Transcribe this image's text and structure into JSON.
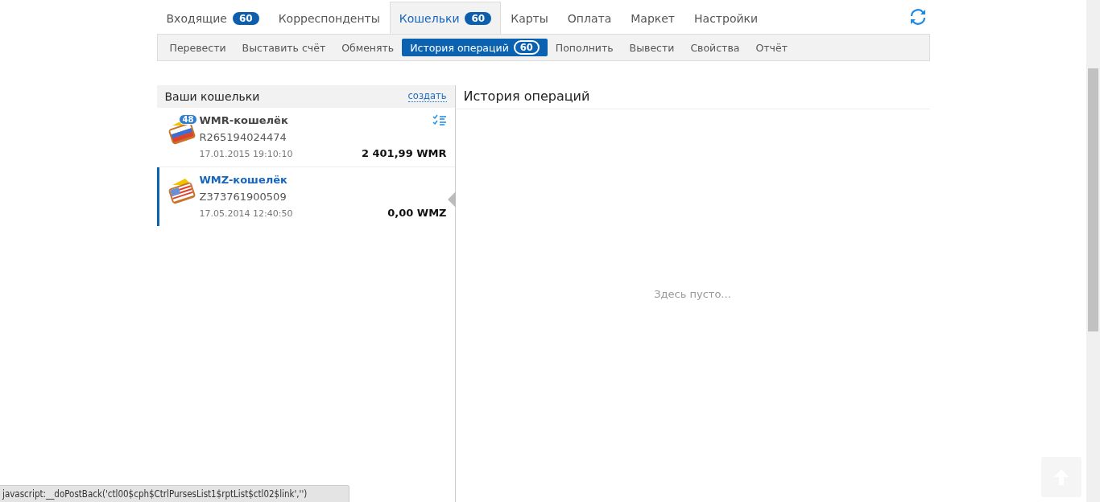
{
  "main_tabs": [
    {
      "label": "Входящие",
      "count": "60",
      "selected": false
    },
    {
      "label": "Корреспонденты",
      "selected": false
    },
    {
      "label": "Кошельки",
      "count": "60",
      "selected": true
    },
    {
      "label": "Карты",
      "selected": false
    },
    {
      "label": "Оплата",
      "selected": false
    },
    {
      "label": "Маркет",
      "selected": false
    },
    {
      "label": "Настройки",
      "selected": false
    }
  ],
  "sub_tabs": [
    {
      "label": "Перевести",
      "selected": false
    },
    {
      "label": "Выставить счёт",
      "selected": false
    },
    {
      "label": "Обменять",
      "selected": false
    },
    {
      "label": "История операций",
      "count": "60",
      "selected": true
    },
    {
      "label": "Пополнить",
      "selected": false
    },
    {
      "label": "Вывести",
      "selected": false
    },
    {
      "label": "Свойства",
      "selected": false
    },
    {
      "label": "Отчёт",
      "selected": false
    }
  ],
  "wallets_panel": {
    "title": "Ваши кошельки",
    "create_link": "создать",
    "wallets": [
      {
        "kind": "ru",
        "badge": "48",
        "name": "WMR-кошелёк",
        "number": "R265194024474",
        "date": "17.01.2015 19:10:10",
        "balance": "2 401,99 WMR",
        "selected": false
      },
      {
        "kind": "us",
        "name": "WMZ-кошелёк",
        "number": "Z373761900509",
        "date": "17.05.2014 12:40:50",
        "balance": "0,00 WMZ",
        "selected": true
      }
    ]
  },
  "history_panel": {
    "title": "История операций",
    "empty_text": "Здесь пусто..."
  },
  "status_bar": {
    "text": "javascript:__doPostBack('ctl00$cph$CtrlPursesList1$rptList$ctl02$link','')"
  }
}
